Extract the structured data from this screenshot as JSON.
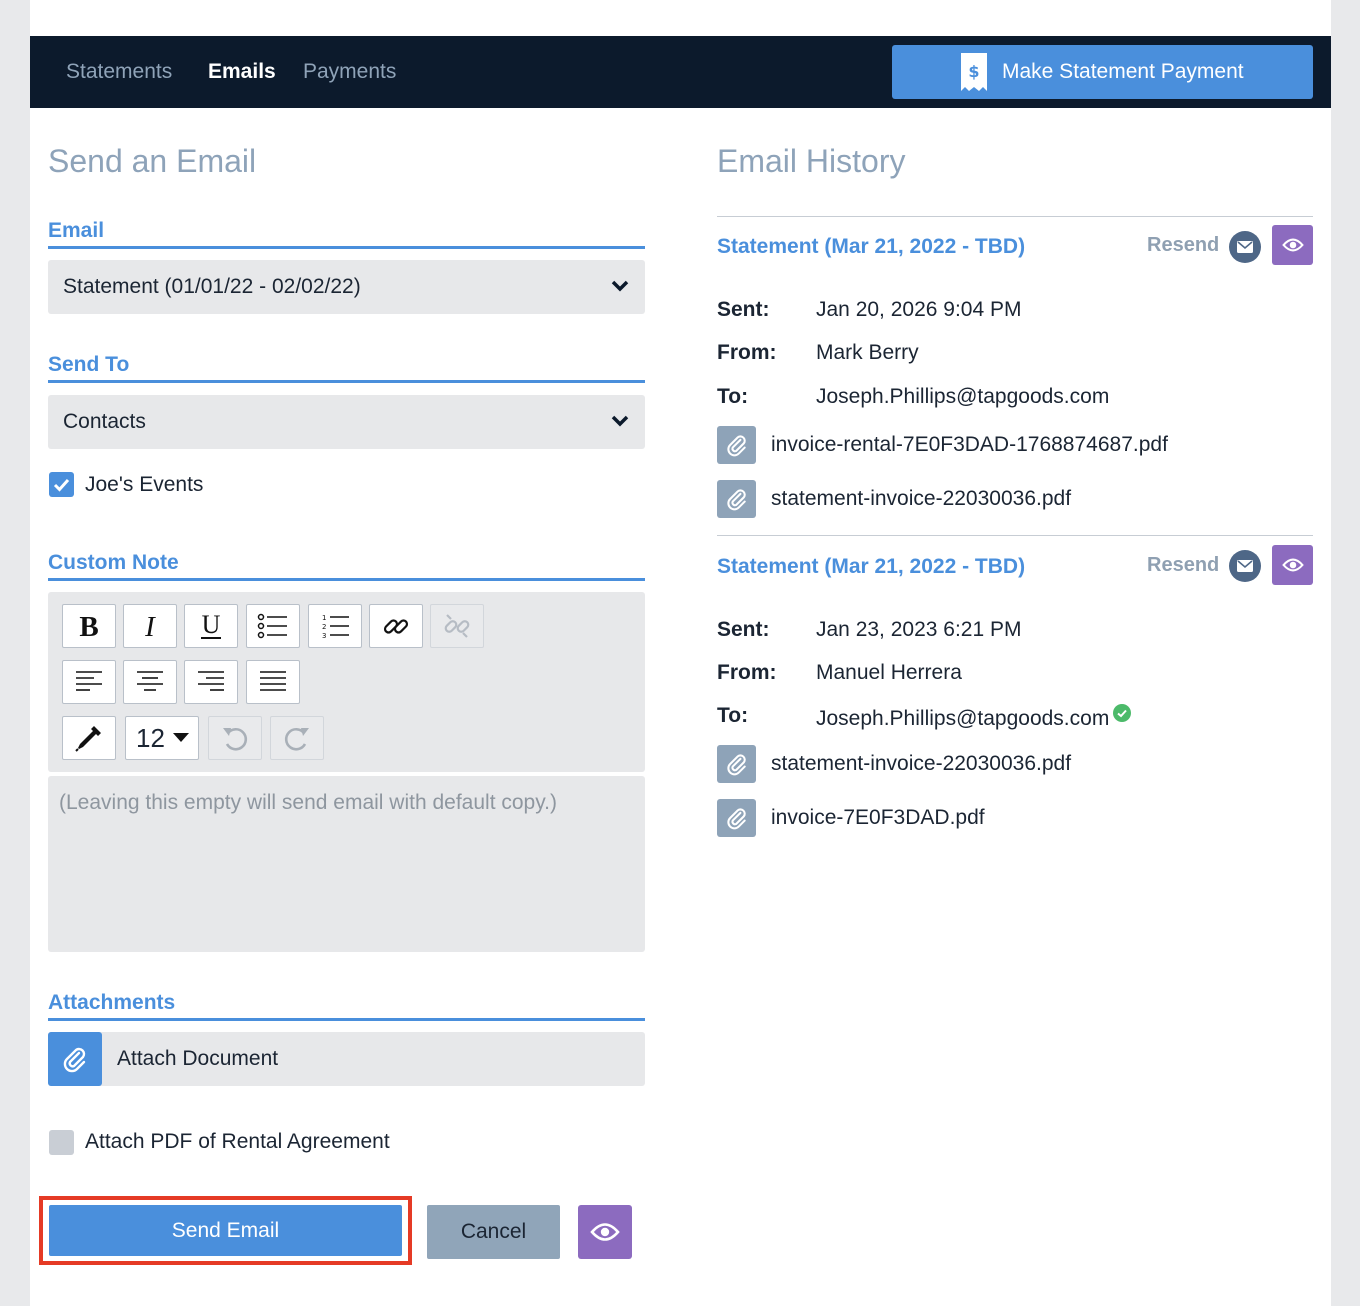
{
  "nav": {
    "tabs": [
      "Statements",
      "Emails",
      "Payments"
    ],
    "active_tab": "Emails",
    "pay_button_label": "Make Statement Payment",
    "pay_button_icon": "receipt-dollar-icon"
  },
  "compose": {
    "title": "Send an Email",
    "email_label": "Email",
    "email_value": "Statement (01/01/22 - 02/02/22)",
    "send_to_label": "Send To",
    "send_to_value": "Contacts",
    "contact_name": "Joe's Events",
    "contact_checked": true,
    "note_label": "Custom Note",
    "font_size": "12",
    "note_placeholder": "(Leaving this empty will send email with default copy.)",
    "attachments_label": "Attachments",
    "attach_document_label": "Attach Document",
    "attach_pdf_label": "Attach PDF of Rental Agreement",
    "attach_pdf_checked": false,
    "send_label": "Send Email",
    "cancel_label": "Cancel"
  },
  "history": {
    "title": "Email History",
    "resend_label": "Resend",
    "sent_key": "Sent:",
    "from_key": "From:",
    "to_key": "To:",
    "entries": [
      {
        "title": "Statement (Mar 21, 2022 - TBD)",
        "sent": "Jan 20, 2026  9:04 PM",
        "from": "Mark Berry",
        "to": "Joseph.Phillips@tapgoods.com",
        "verified": false,
        "files": [
          "invoice-rental-7E0F3DAD-1768874687.pdf",
          "statement-invoice-22030036.pdf"
        ]
      },
      {
        "title": "Statement (Mar 21, 2022 - TBD)",
        "sent": "Jan 23, 2023  6:21 PM",
        "from": "Manuel Herrera",
        "to": "Joseph.Phillips@tapgoods.com",
        "verified": true,
        "files": [
          "statement-invoice-22030036.pdf",
          "invoice-7E0F3DAD.pdf"
        ]
      }
    ]
  },
  "colors": {
    "accent": "#4a8fdc",
    "nav_bg": "#0c1a2c",
    "preview": "#8c6bbf",
    "highlight": "#e53a25",
    "verified": "#4cba6a"
  }
}
